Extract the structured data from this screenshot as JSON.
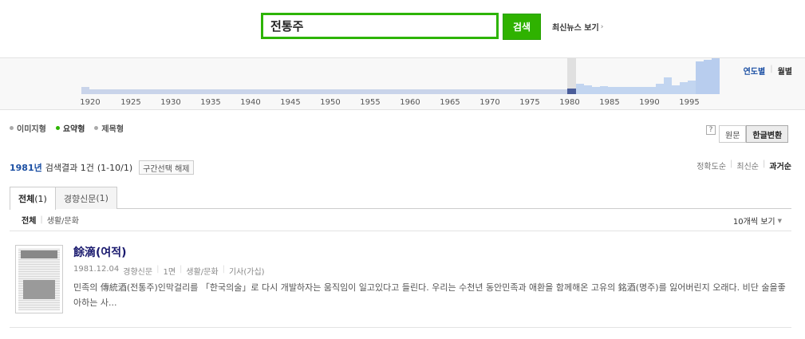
{
  "search": {
    "query": "전통주",
    "button_label": "검색",
    "latest_news_label": "최신뉴스 보기"
  },
  "timeline": {
    "year_labels": [
      "1920",
      "1925",
      "1930",
      "1935",
      "1940",
      "1945",
      "1950",
      "1955",
      "1960",
      "1965",
      "1970",
      "1975",
      "1980",
      "1985",
      "1990",
      "1995"
    ],
    "toggle_by_year": "연도별",
    "toggle_by_month": "월별",
    "selected_year": 1981
  },
  "view_modes": {
    "image": "이미지형",
    "summary": "요약형",
    "title": "제목형",
    "active": "summary"
  },
  "conversion": {
    "help": "?",
    "original": "원문",
    "hangul": "한글변환",
    "active": "hangul"
  },
  "summary": {
    "year": "1981년",
    "result_text": "검색결과 1건",
    "range": "(1-10/1)",
    "reset_label": "구간선택 해제"
  },
  "sort": {
    "accuracy": "정확도순",
    "newest": "최신순",
    "oldest": "과거순",
    "active": "oldest"
  },
  "tabs": [
    {
      "label": "전체",
      "count": "(1)",
      "active": true
    },
    {
      "label": "경향신문",
      "count": "(1)",
      "active": false
    }
  ],
  "subbar": {
    "all": "전체",
    "category": "생활/문화",
    "per_page": "10개씩 보기"
  },
  "results": [
    {
      "title": "餘滴(여적)",
      "date": "1981.12.04",
      "paper": "경향신문",
      "page": "1면",
      "category": "생활/문화",
      "type": "기사(가십)",
      "snippet": "민족의 傳統酒(전통주)인막걸리를 「한국의술」로 다시 개발하자는 움직임이 일고있다고 들린다. 우리는 수천년 동안민족과 애환을 함께해온 고유의 銘酒(명주)를 잃어버린지 오래다. 비단 술을좋아하는 사..."
    }
  ],
  "colors": {
    "accent_green": "#2db400",
    "link_blue": "#1b4fa3",
    "bar_blue": "#b8cdee",
    "bar_selected": "#4a5d9a"
  }
}
